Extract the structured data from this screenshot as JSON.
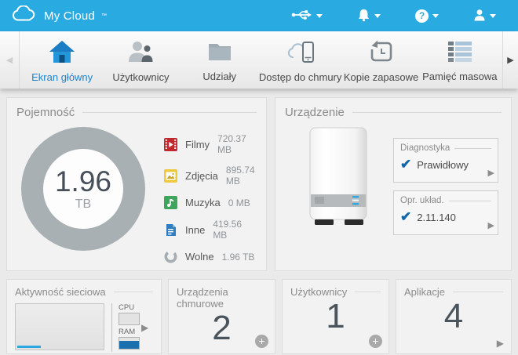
{
  "topbar": {
    "brand": "My Cloud",
    "trademark": "™",
    "icons": [
      "usb-icon",
      "alerts-bell-icon",
      "help-icon",
      "user-icon"
    ]
  },
  "nav": {
    "items": [
      {
        "label": "Ekran główny",
        "icon": "home-icon",
        "active": true
      },
      {
        "label": "Użytkownicy",
        "icon": "users-icon",
        "active": false
      },
      {
        "label": "Udziały",
        "icon": "shares-folder-icon",
        "active": false
      },
      {
        "label": "Dostęp do chmury",
        "icon": "cloud-access-icon",
        "active": false
      },
      {
        "label": "Kopie zapasowe",
        "icon": "backups-icon",
        "active": false
      },
      {
        "label": "Pamięć masowa",
        "icon": "storage-icon",
        "active": false
      }
    ]
  },
  "capacity": {
    "title": "Pojemność",
    "total_value": "1.96",
    "total_unit": "TB",
    "items": [
      {
        "icon": "videos-icon",
        "label": "Filmy",
        "value": "720.37 MB",
        "color": "#c2282e"
      },
      {
        "icon": "photos-icon",
        "label": "Zdjęcia",
        "value": "895.74 MB",
        "color": "#edc93b"
      },
      {
        "icon": "music-icon",
        "label": "Muzyka",
        "value": "0 MB",
        "color": "#3fa45c"
      },
      {
        "icon": "other-files-icon",
        "label": "Inne",
        "value": "419.56 MB",
        "color": "#2e7dc2"
      },
      {
        "icon": "free-space-icon",
        "label": "Wolne",
        "value": "1.96 TB",
        "color": "#a6adb2"
      }
    ]
  },
  "device": {
    "title": "Urządzenie",
    "diagnostics": {
      "title": "Diagnostyka",
      "status": "Prawidłowy"
    },
    "firmware": {
      "title": "Opr. układ.",
      "version": "2.11.140"
    }
  },
  "panels": {
    "network": {
      "title": "Aktywność sieciowa",
      "cpu_label": "CPU",
      "ram_label": "RAM"
    },
    "cloud_devices": {
      "title": "Urządzenia chmurowe",
      "count": "2"
    },
    "users": {
      "title": "Użytkownicy",
      "count": "1"
    },
    "apps": {
      "title": "Aplikacje",
      "count": "4"
    }
  },
  "colors": {
    "topbar_blue": "#29abe2",
    "active_tab_blue": "#1e83ca",
    "check_blue": "#1266a5",
    "ram_fill_blue": "#1a6fad",
    "donut_gray": "#a9b0b3",
    "number_text": "#4a545c"
  }
}
